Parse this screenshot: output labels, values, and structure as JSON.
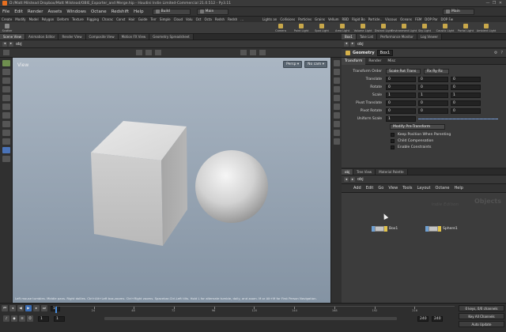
{
  "title_bar": {
    "text": "D:/Matt Milstead Dropbox/Matt Milstead/OBIE_Exporter_and Merge.hip - Houdini Indie Limited-Commercial 21.0.512 - Py3.11",
    "controls": [
      "—",
      "❐",
      "✕"
    ]
  },
  "menu": {
    "items": [
      "File",
      "Edit",
      "Render",
      "Assets",
      "Windows",
      "Octane",
      "Redshift",
      "Help"
    ],
    "build_label": "Build",
    "desktop_left": "Main",
    "desktop_right": "Main"
  },
  "shelf": {
    "tabs": [
      "Create",
      "Modify",
      "Model",
      "Polygon",
      "Deform",
      "Texture",
      "Rigging",
      "Charac",
      "Const",
      "Hair",
      "Guide",
      "Terr",
      "Simple",
      "Cloud",
      "Volu",
      "Oct",
      "Octa",
      "Redsh",
      "Redsh",
      "..."
    ],
    "tools": [
      "Scatter"
    ],
    "right_tabs": [
      "Lights an",
      "Collisions",
      "Particles",
      "Grains",
      "Vellum",
      "RBD",
      "Rigid Bo",
      "Particle..",
      "Viscous",
      "Oceans",
      "FEM",
      "DOP Par",
      "DOP Fw"
    ],
    "right_tools": [
      "Camera",
      "Point Light",
      "Spot Light",
      "Area Light",
      "Volume Light",
      "Distant Light",
      "Environment Light",
      "Sky Light",
      "Caustic Light",
      "Portal Light",
      "Ambient Light"
    ]
  },
  "scene_tabs": [
    "Scene View",
    "Animation Editor",
    "Render View",
    "Composite View",
    "Motion FX View",
    "Geometry Spreadsheet"
  ],
  "scene_path": "obj",
  "viewport": {
    "label": "View",
    "cam_buttons": [
      "Persp ▾",
      "No cam ▾"
    ],
    "hint": "Left mouse tumbles. Middle pans. Right dollies. Ctrl+Alt+Left box-zooms. Ctrl+Right zooms. Spacebar-Ctrl-Left tilts. Hold L for alternate tumble, dolly, and zoom. M or Alt+M for First Person Navigation."
  },
  "timeline": {
    "current_frame": "1",
    "start": "1",
    "start2": "1",
    "end": "240",
    "end2": "240",
    "tick_labels": [
      "24",
      "48",
      "72",
      "96",
      "120",
      "144",
      "168",
      "192",
      "216"
    ],
    "keys_label": "0 keys, 0/0 channels",
    "key_all_label": "Key All Channels",
    "auto_update_label": "Auto Update"
  },
  "param_tabs": [
    "Box1",
    "Take List",
    "Performance Monitor",
    "Log Viewer"
  ],
  "param_path": "obj",
  "param": {
    "type_label": "Geometry",
    "node_name": "Box1",
    "subtabs": [
      "Transform",
      "Render",
      "Misc"
    ],
    "transform_order_label": "Transform Order",
    "transform_order_value": "Scale Rot Trans",
    "rot_order_value": "Rx Ry Rz",
    "translate_label": "Translate",
    "translate": [
      "0",
      "0",
      "0"
    ],
    "rotate_label": "Rotate",
    "rotate": [
      "0",
      "0",
      "0"
    ],
    "scale_label": "Scale",
    "scale": [
      "1",
      "1",
      "1"
    ],
    "pivot_translate_label": "Pivot Translate",
    "pivot_translate": [
      "0",
      "0",
      "0"
    ],
    "pivot_rotate_label": "Pivot Rotate",
    "pivot_rotate": [
      "0",
      "0",
      "0"
    ],
    "uniform_scale_label": "Uniform Scale",
    "uniform_scale": "1",
    "pretransform_label": "Modify Pre-Transform",
    "keep_position_label": "Keep Position When Parenting",
    "child_comp_label": "Child Compensation",
    "enable_constraints_label": "Enable Constraints"
  },
  "net_tabs": [
    "obj",
    "Tree View",
    "Material Palette"
  ],
  "net_path": "obj",
  "net_menu": [
    "Add",
    "Edit",
    "Go",
    "View",
    "Tools",
    "Layout",
    "Octane",
    "Help"
  ],
  "network": {
    "watermark_context": "Objects",
    "watermark_edition": "Indie Edition",
    "nodes": [
      {
        "name": "Box1"
      },
      {
        "name": "Sphere1"
      }
    ]
  }
}
